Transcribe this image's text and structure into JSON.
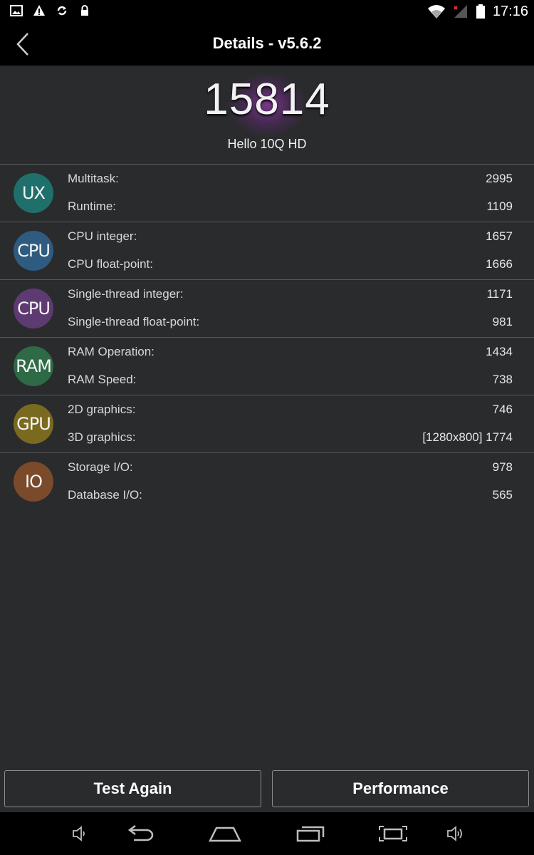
{
  "status_bar": {
    "time": "17:16",
    "icons": [
      "image-icon",
      "warning-icon",
      "sync-icon",
      "lock-icon",
      "wifi-icon",
      "signal-icon",
      "battery-icon"
    ]
  },
  "app_bar": {
    "title": "Details - v5.6.2",
    "back_icon": "chevron-left-icon"
  },
  "summary": {
    "total_score": "15814",
    "device_name": "Hello 10Q HD"
  },
  "categories": [
    {
      "badge": "UX",
      "color": "#1f6f6b",
      "items": [
        {
          "label": "Multitask:",
          "value": "2995"
        },
        {
          "label": "Runtime:",
          "value": "1109"
        }
      ]
    },
    {
      "badge": "CPU",
      "color": "#2f5b80",
      "items": [
        {
          "label": "CPU integer:",
          "value": "1657"
        },
        {
          "label": "CPU float-point:",
          "value": "1666"
        }
      ]
    },
    {
      "badge": "CPU",
      "color": "#5e3a72",
      "items": [
        {
          "label": "Single-thread integer:",
          "value": "1171"
        },
        {
          "label": "Single-thread float-point:",
          "value": "981"
        }
      ]
    },
    {
      "badge": "RAM",
      "color": "#2d6a45",
      "items": [
        {
          "label": "RAM Operation:",
          "value": "1434"
        },
        {
          "label": "RAM Speed:",
          "value": "738"
        }
      ]
    },
    {
      "badge": "GPU",
      "color": "#7a6a1f",
      "items": [
        {
          "label": "2D graphics:",
          "value": "746"
        },
        {
          "label": "3D graphics:",
          "value": "[1280x800] 1774"
        }
      ]
    },
    {
      "badge": "IO",
      "color": "#7a4a2a",
      "items": [
        {
          "label": "Storage I/O:",
          "value": "978"
        },
        {
          "label": "Database I/O:",
          "value": "565"
        }
      ]
    }
  ],
  "buttons": {
    "test_again": "Test Again",
    "performance": "Performance"
  },
  "nav_bar": {
    "icons": [
      "volume-down-icon",
      "back-icon",
      "home-icon",
      "recents-icon",
      "screenshot-icon",
      "volume-up-icon"
    ]
  }
}
